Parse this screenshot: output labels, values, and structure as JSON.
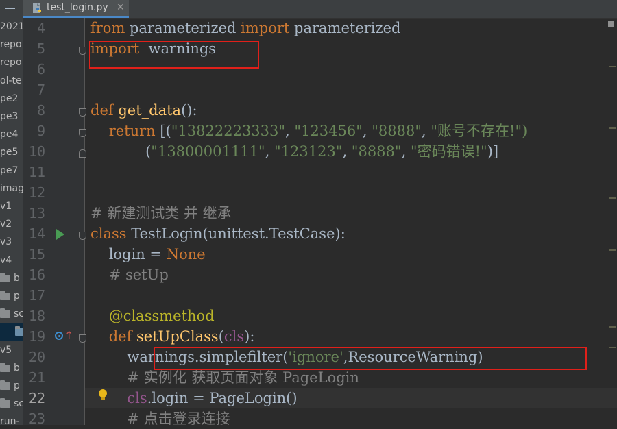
{
  "tab": {
    "filename": "test_login.py",
    "close": "✕",
    "icon": "python-file-icon"
  },
  "sidebar": {
    "items": [
      {
        "label": "2021",
        "icon": ""
      },
      {
        "label": "repo",
        "icon": ""
      },
      {
        "label": "repo",
        "icon": ""
      },
      {
        "label": "ol-te",
        "icon": ""
      },
      {
        "label": "pe2",
        "icon": ""
      },
      {
        "label": "pe3",
        "icon": ""
      },
      {
        "label": "pe4",
        "icon": ""
      },
      {
        "label": "pe5",
        "icon": ""
      },
      {
        "label": "pe7",
        "icon": ""
      },
      {
        "label": "imag",
        "icon": ""
      },
      {
        "label": "v1",
        "icon": ""
      },
      {
        "label": "v2",
        "icon": ""
      },
      {
        "label": "v3",
        "icon": ""
      },
      {
        "label": "v4",
        "icon": ""
      },
      {
        "label": "b",
        "icon": "folder-icon"
      },
      {
        "label": "p",
        "icon": "folder-icon"
      },
      {
        "label": "sc",
        "icon": "folder-icon"
      },
      {
        "label": "",
        "icon": "python-file-icon"
      },
      {
        "label": "v5",
        "icon": ""
      },
      {
        "label": "b",
        "icon": "folder-icon"
      },
      {
        "label": "p",
        "icon": "folder-icon"
      },
      {
        "label": "sc",
        "icon": "folder-icon"
      },
      {
        "label": "run-",
        "icon": ""
      }
    ]
  },
  "editor": {
    "current_line": "22",
    "lines": [
      {
        "num": "4"
      },
      {
        "num": "5"
      },
      {
        "num": "6"
      },
      {
        "num": "7"
      },
      {
        "num": "8"
      },
      {
        "num": "9"
      },
      {
        "num": "10"
      },
      {
        "num": "11"
      },
      {
        "num": "12"
      },
      {
        "num": "13"
      },
      {
        "num": "14"
      },
      {
        "num": "15"
      },
      {
        "num": "16"
      },
      {
        "num": "17"
      },
      {
        "num": "18"
      },
      {
        "num": "19"
      },
      {
        "num": "20"
      },
      {
        "num": "21"
      },
      {
        "num": "22"
      },
      {
        "num": "23"
      }
    ],
    "code": {
      "l4_from": "from",
      "l4_mod": " parameterized ",
      "l4_import": "import",
      "l4_name": " parameterized",
      "l5_import": "import",
      "l5_name": "  warnings",
      "l8_def": "def",
      "l8_fn": " get_data",
      "l8_rest": "():",
      "l9_return": "    return",
      "l9_open": " [(",
      "l9_s1": "\"13822223333\"",
      "l9_c1": ", ",
      "l9_s2": "\"123456\"",
      "l9_c2": ", ",
      "l9_s3": "\"8888\"",
      "l9_c3": ", ",
      "l9_s4": "\"账号不存在!\")",
      "l10_open": "            (",
      "l10_s1": "\"13800001111\"",
      "l10_c1": ", ",
      "l10_s2": "\"123123\"",
      "l10_c2": ", ",
      "l10_s3": "\"8888\"",
      "l10_c3": ", ",
      "l10_s4": "\"密码错误!\"",
      "l10_close": ")]",
      "l13_comment": "# 新建测试类 并 继承",
      "l14_class": "class",
      "l14_name": " TestLogin",
      "l14_rest": "(unittest.TestCase):",
      "l15_ind": "    login = ",
      "l15_none": "None",
      "l16_comment": "    # setUp",
      "l18_dec": "    @classmethod",
      "l19_def": "    def",
      "l19_fn": " setUpClass",
      "l19_open": "(",
      "l19_cls": "cls",
      "l19_close": "):",
      "l20_a": "        warnings.simplefilter(",
      "l20_s": "'ignore'",
      "l20_b": ",ResourceWarning)",
      "l21_comment": "        # 实例化 获取页面对象 PageLogin",
      "l22_ind": "        ",
      "l22_cls": "cls",
      "l22_rest": ".login = PageLogin()",
      "l23_comment": "        # 点击登录连接"
    }
  }
}
